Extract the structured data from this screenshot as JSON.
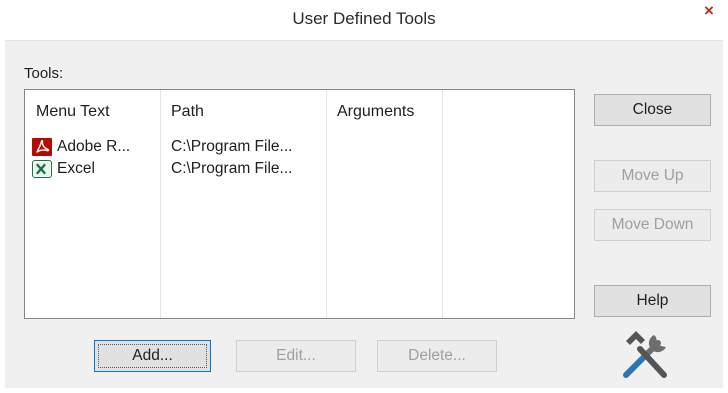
{
  "window": {
    "title": "User Defined Tools",
    "close_glyph": "×"
  },
  "tools_label": "Tools:",
  "list": {
    "columns": [
      "Menu Text",
      "Path",
      "Arguments",
      ""
    ],
    "rows": [
      {
        "menu_text": "Adobe R...",
        "path": "C:\\Program File...",
        "arguments": "",
        "icon": "adobe-reader-icon"
      },
      {
        "menu_text": "Excel",
        "path": "C:\\Program File...",
        "arguments": "",
        "icon": "excel-icon"
      }
    ]
  },
  "buttons": {
    "close": "Close",
    "move_up": "Move Up",
    "move_down": "Move Down",
    "help": "Help",
    "add": "Add...",
    "edit": "Edit...",
    "delete": "Delete..."
  },
  "button_states": {
    "move_up": "disabled",
    "move_down": "disabled",
    "edit": "disabled",
    "delete": "disabled",
    "add": "default-focused"
  },
  "decor": {
    "graphic": "tools-hammer-wrench-icon"
  },
  "colors": {
    "client_bg": "#f0f0f0",
    "close_x": "#c42b1c",
    "adobe_red": "#b30b00",
    "excel_green": "#1e7145",
    "wrench_blue": "#2e75b6"
  }
}
